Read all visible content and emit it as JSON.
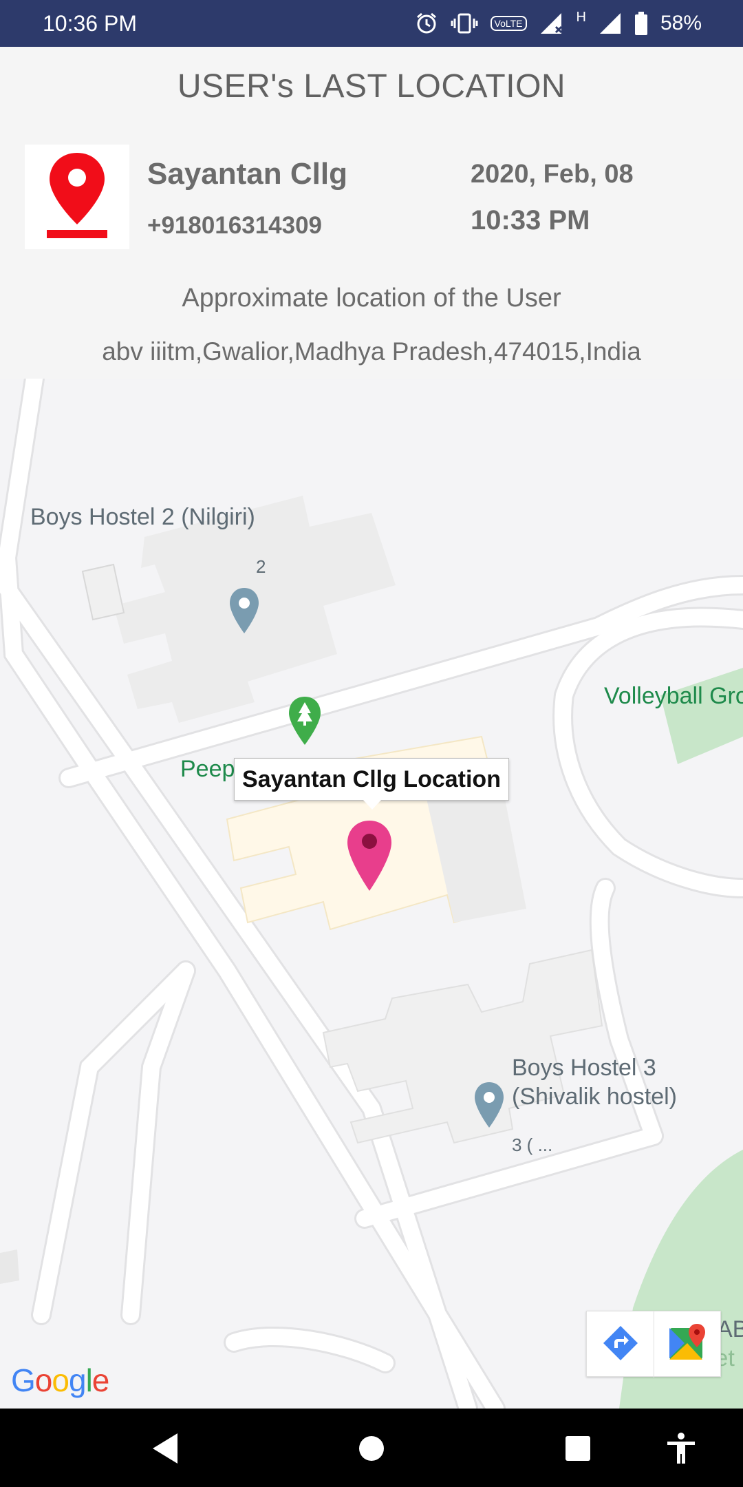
{
  "status_bar": {
    "time": "10:36 PM",
    "network_h": "H",
    "volte": "VoLTE",
    "battery": "58%"
  },
  "header": {
    "title": "USER's LAST LOCATION",
    "user_name": "Sayantan Cllg",
    "phone": "+918016314309",
    "date": "2020, Feb, 08",
    "time": "10:33 PM",
    "approx_label": "Approximate location of the User",
    "address": "abv iiitm,Gwalior,Madhya Pradesh,474015,India"
  },
  "map": {
    "labels": {
      "boys_hostel_2": "Boys Hostel 2 (Nilgiri)",
      "boys_hostel_2_num": "2",
      "volleyball": "Volleyball Gro",
      "peep": "Peep",
      "boys_hostel_3_line1": "Boys Hostel 3",
      "boys_hostel_3_line2": "(Shivalik hostel)",
      "boys_hostel_3_num": "3 (       ...",
      "ab_cricket_1": "AB",
      "ab_cricket_2": "Cricket"
    },
    "info_window": "Sayantan Cllg Location",
    "google_logo": [
      "G",
      "o",
      "o",
      "g",
      "l",
      "e"
    ],
    "colors": {
      "marker": "#e83e8c",
      "poi_pin": "#7a9cb0",
      "park": "#c8e6c9",
      "park_pin": "#3fad4a"
    }
  },
  "icons": {
    "logo": "location-pin-icon",
    "directions": "directions-icon",
    "google_maps": "google-maps-icon",
    "back": "back-icon",
    "home": "home-icon",
    "recents": "recents-icon",
    "accessibility": "accessibility-icon"
  }
}
